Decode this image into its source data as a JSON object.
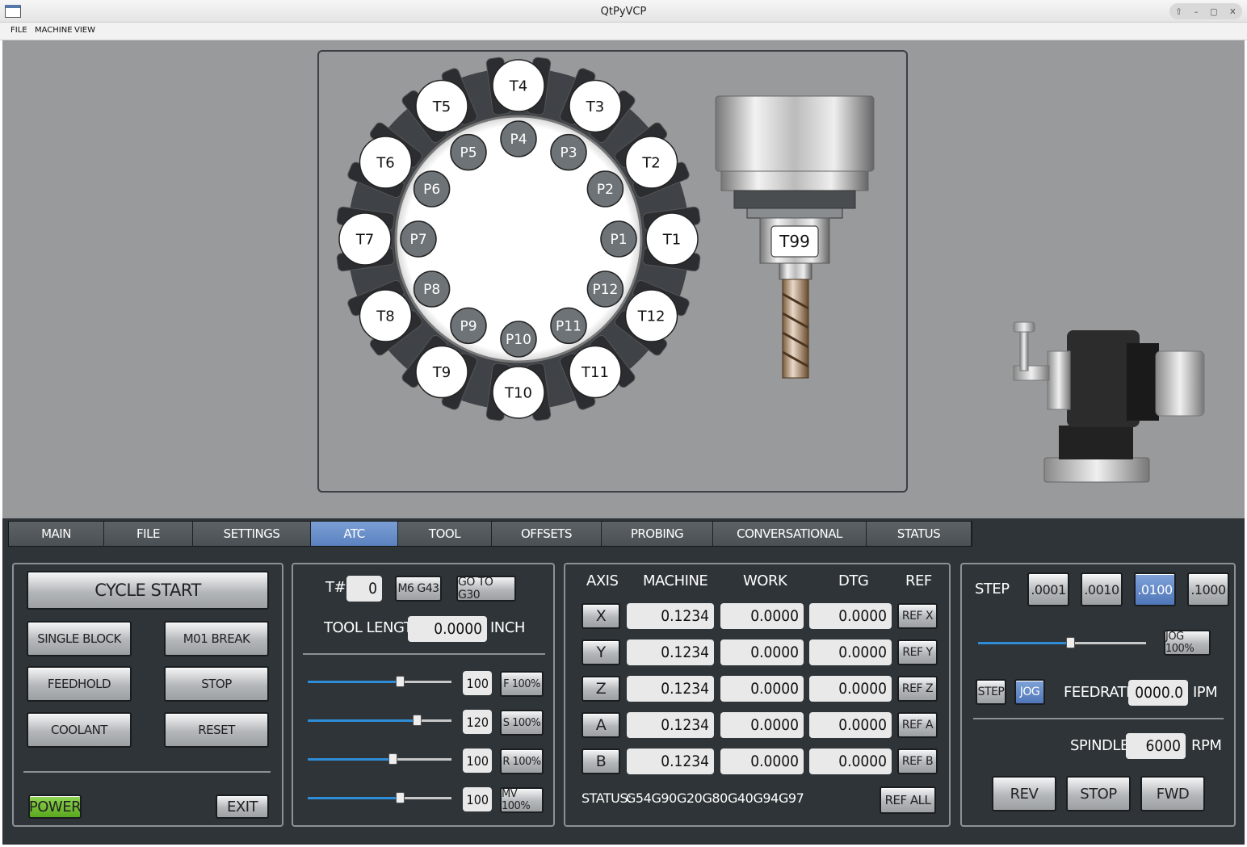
{
  "window": {
    "title": "QtPyVCP"
  },
  "menu": {
    "file": "FILE",
    "machine": "MACHINE",
    "view": "VIEW"
  },
  "atc": {
    "pockets_tools": [
      "T1",
      "T2",
      "T3",
      "T4",
      "T5",
      "T6",
      "T7",
      "T8",
      "T9",
      "T10",
      "T11",
      "T12"
    ],
    "pockets": [
      "P1",
      "P2",
      "P3",
      "P4",
      "P5",
      "P6",
      "P7",
      "P8",
      "P9",
      "P10",
      "P11",
      "P12"
    ],
    "spindle_tool": "T99"
  },
  "tabs": [
    "MAIN",
    "FILE",
    "SETTINGS",
    "ATC",
    "TOOL",
    "OFFSETS",
    "PROBING",
    "CONVERSATIONAL",
    "STATUS"
  ],
  "active_tab": "ATC",
  "controls": {
    "cycle_start": "CYCLE START",
    "single_block": "SINGLE BLOCK",
    "m01_break": "M01 BREAK",
    "feedhold": "FEEDHOLD",
    "stop": "STOP",
    "coolant": "COOLANT",
    "reset": "RESET",
    "power": "POWER",
    "exit": "EXIT"
  },
  "tool": {
    "tnum_label": "T#",
    "tnum_value": "0",
    "m6g43": "M6 G43",
    "goto_g30": "GO TO G30",
    "length_label": "TOOL LENGTH",
    "length_value": "0.0000",
    "length_unit": "INCH"
  },
  "overrides": [
    {
      "value": "100",
      "button": "F 100%",
      "level": 0.64
    },
    {
      "value": "120",
      "button": "S 100%",
      "level": 0.76
    },
    {
      "value": "100",
      "button": "R 100%",
      "level": 0.59
    },
    {
      "value": "100",
      "button": "MV 100%",
      "level": 0.64
    }
  ],
  "dro": {
    "headers": {
      "axis": "AXIS",
      "machine": "MACHINE",
      "work": "WORK",
      "dtg": "DTG",
      "ref": "REF"
    },
    "rows": [
      {
        "axis": "X",
        "machine": "0.1234",
        "work": "0.0000",
        "dtg": "0.0000",
        "ref": "REF X"
      },
      {
        "axis": "Y",
        "machine": "0.1234",
        "work": "0.0000",
        "dtg": "0.0000",
        "ref": "REF Y"
      },
      {
        "axis": "Z",
        "machine": "0.1234",
        "work": "0.0000",
        "dtg": "0.0000",
        "ref": "REF Z"
      },
      {
        "axis": "A",
        "machine": "0.1234",
        "work": "0.0000",
        "dtg": "0.0000",
        "ref": "REF A"
      },
      {
        "axis": "B",
        "machine": "0.1234",
        "work": "0.0000",
        "dtg": "0.0000",
        "ref": "REF B"
      }
    ],
    "status_label": "STATUS:",
    "gcodes": [
      "G54",
      "G90",
      "G20",
      "G80",
      "G40",
      "G94",
      "G97"
    ],
    "ref_all": "REF ALL"
  },
  "jog": {
    "step_label": "STEP",
    "steps": [
      ".0001",
      ".0010",
      ".0100",
      ".1000"
    ],
    "active_step": ".0100",
    "jog_rate": "JOG 100%",
    "jog_level": 0.55,
    "mode_step": "STEP",
    "mode_jog": "JOG",
    "feedrate_label": "FEEDRATE",
    "feedrate_value": "0000.0",
    "feedrate_unit": "IPM",
    "spindle_label": "SPINDLE",
    "spindle_value": "6000",
    "spindle_unit": "RPM",
    "rev": "REV",
    "stop": "STOP",
    "fwd": "FWD"
  },
  "colors": {
    "accent_blue": "#5b82c0",
    "power_green": "#6bbf2a",
    "panel_bg": "#2e3437",
    "view_bg": "#999a9b"
  }
}
